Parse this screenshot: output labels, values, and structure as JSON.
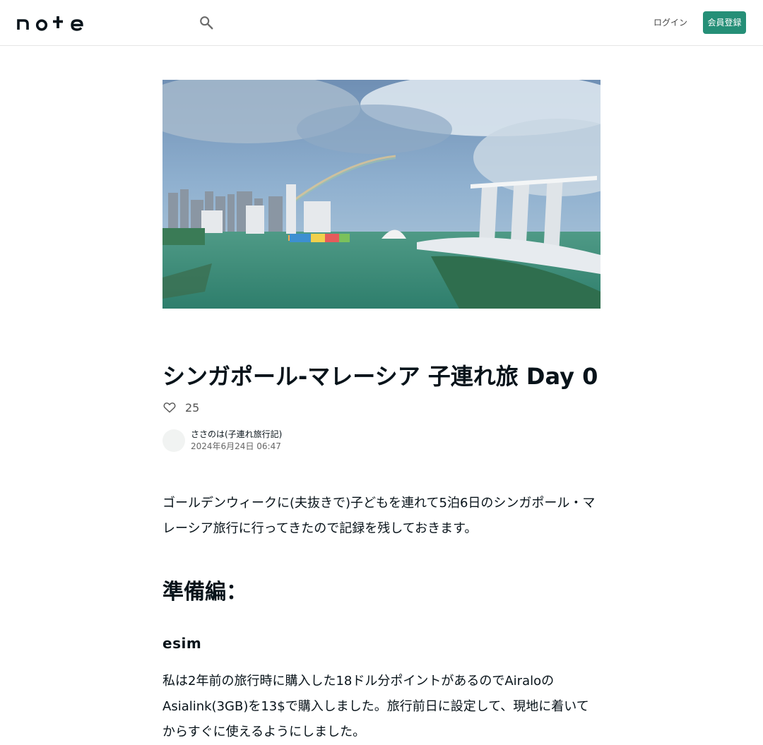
{
  "header": {
    "login_label": "ログイン",
    "signup_label": "会員登録"
  },
  "article": {
    "title": "シンガポール-マレーシア 子連れ旅 Day 0",
    "likes": "25",
    "author": "ささのは(子連れ旅行記)",
    "date": "2024年6月24日 06:47",
    "intro": "ゴールデンウィークに(夫抜きで)子どもを連れて5泊6日のシンガポール・マレーシア旅行に行ってきたので記録を残しておきます。",
    "section_heading": "準備編：",
    "subheading": "esim",
    "paragraph2": "私は2年前の旅行時に購入した18ドル分ポイントがあるのでAiraloのAsialink(3GB)を13$で購入しました。旅行前日に設定して、現地に着いてからすぐに使えるようにしました。"
  },
  "icons": {
    "search": "search-icon",
    "like": "heart-icon"
  },
  "colors": {
    "accent": "#258f77"
  }
}
